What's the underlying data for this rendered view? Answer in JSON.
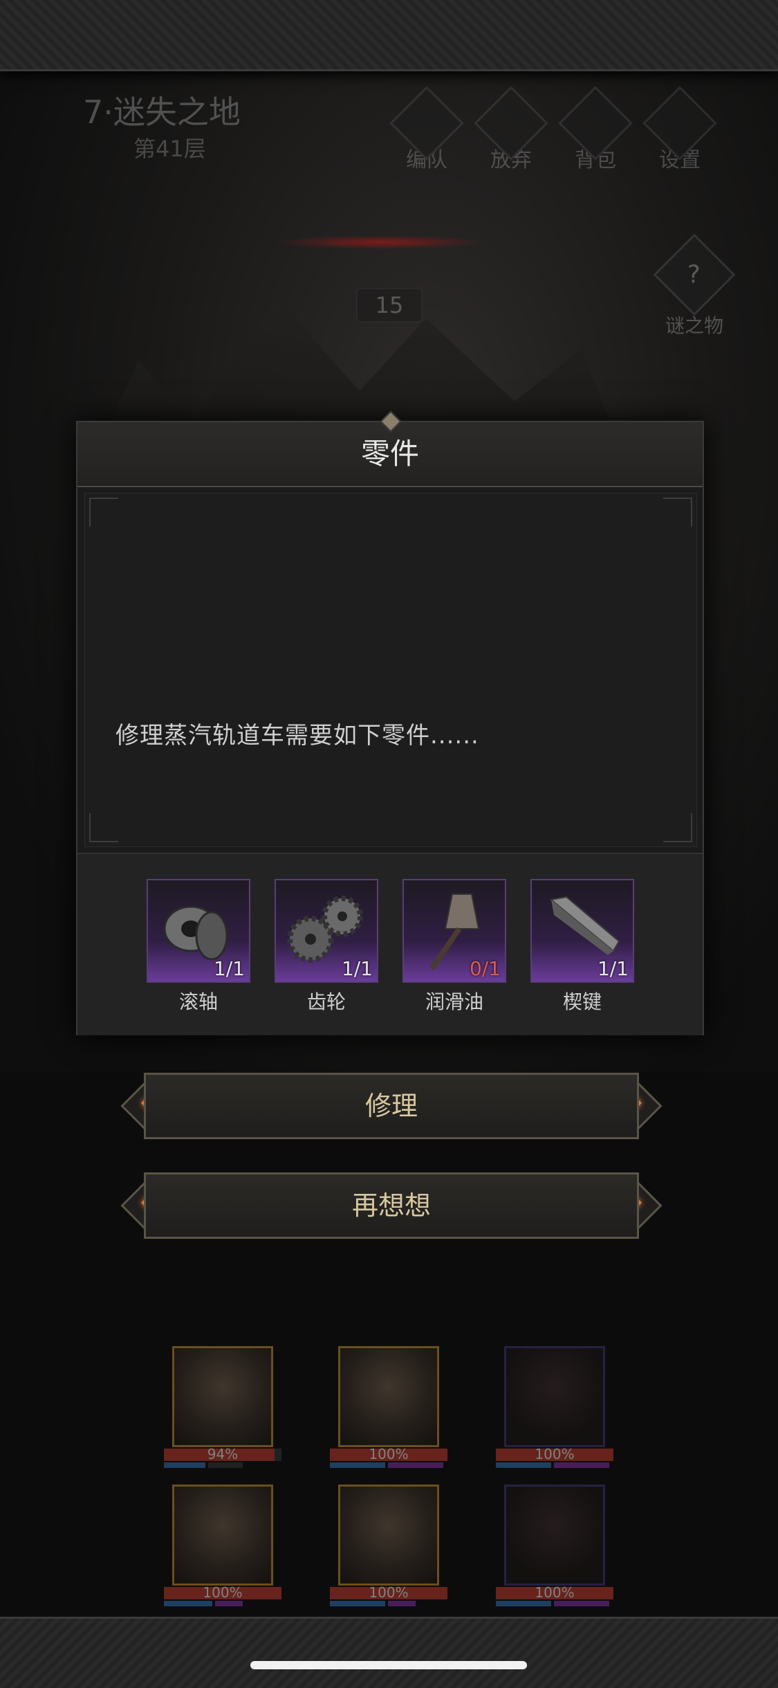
{
  "header": {
    "level_title": "7·迷失之地",
    "floor": "第41层",
    "buttons": [
      {
        "label": "编队",
        "icon": "formation-icon"
      },
      {
        "label": "放弃",
        "icon": "abandon-icon"
      },
      {
        "label": "背包",
        "icon": "backpack-icon"
      },
      {
        "label": "设置",
        "icon": "settings-icon"
      }
    ]
  },
  "counter": "15",
  "mystery": {
    "label": "谜之物",
    "icon": "question-icon"
  },
  "dialog": {
    "title": "零件",
    "message": "修理蒸汽轨道车需要如下零件......",
    "parts": [
      {
        "name": "滚轴",
        "count": "1/1",
        "icon": "bearing-icon",
        "missing": false
      },
      {
        "name": "齿轮",
        "count": "1/1",
        "icon": "gears-icon",
        "missing": false
      },
      {
        "name": "润滑油",
        "count": "0/1",
        "icon": "oil-funnel-icon",
        "missing": true
      },
      {
        "name": "楔键",
        "count": "1/1",
        "icon": "wedge-key-icon",
        "missing": false
      }
    ]
  },
  "actions": {
    "repair": "修理",
    "reconsider": "再想想"
  },
  "heroes": [
    {
      "hp": "94%",
      "hp_fraction": 0.94
    },
    {
      "hp": "100%",
      "hp_fraction": 1.0
    },
    {
      "hp": "100%",
      "hp_fraction": 1.0
    },
    {
      "hp": "100%",
      "hp_fraction": 1.0
    },
    {
      "hp": "100%",
      "hp_fraction": 1.0
    },
    {
      "hp": "100%",
      "hp_fraction": 1.0
    }
  ],
  "colors": {
    "accent_orange": "#e07a3a",
    "hp_red": "#b3362a",
    "missing_red": "#e05a4a",
    "rarity_purple": "#6a3c99"
  }
}
